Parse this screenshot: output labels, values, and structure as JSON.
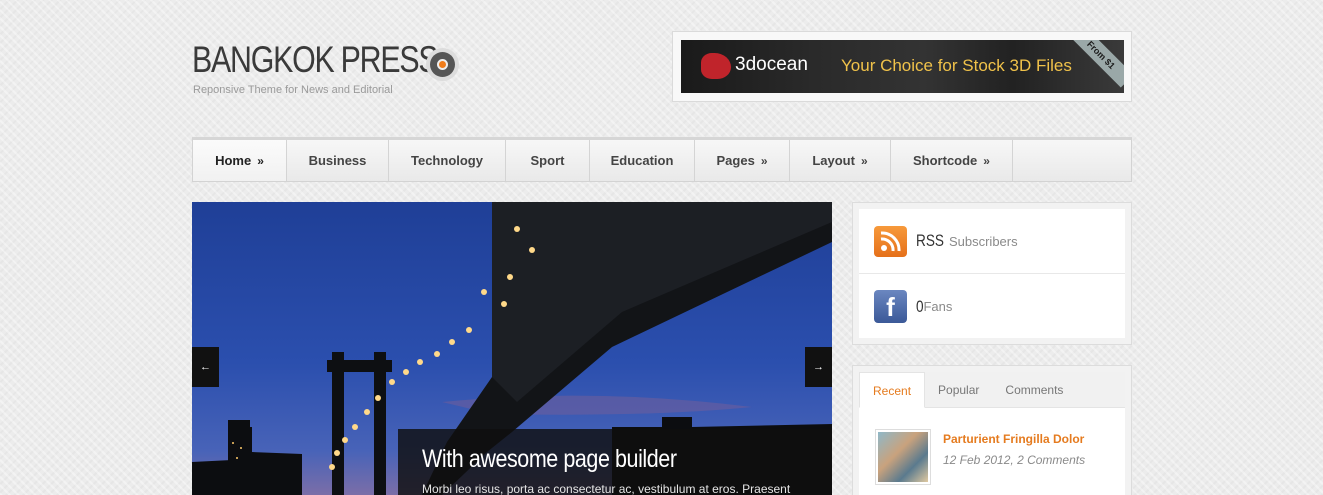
{
  "logo": {
    "title": "BANGKOK PRESS",
    "tagline": "Reponsive Theme for News and Editorial"
  },
  "ad": {
    "brand": "3docean",
    "slogan": "Your Choice for Stock 3D Files",
    "ribbon": "From $1"
  },
  "nav": {
    "items": [
      {
        "label": "Home",
        "arrow": "»"
      },
      {
        "label": "Business",
        "arrow": ""
      },
      {
        "label": "Technology",
        "arrow": ""
      },
      {
        "label": "Sport",
        "arrow": ""
      },
      {
        "label": "Education",
        "arrow": ""
      },
      {
        "label": "Pages",
        "arrow": "»"
      },
      {
        "label": "Layout",
        "arrow": "»"
      },
      {
        "label": "Shortcode",
        "arrow": "»"
      }
    ]
  },
  "slider": {
    "prev": "←",
    "next": "→",
    "caption_title": "With awesome page builder",
    "caption_text": "Morbi leo risus, porta ac consectetur ac, vestibulum at eros. Praesent"
  },
  "social": {
    "rss": {
      "count": "RSS",
      "label": "Subscribers"
    },
    "facebook": {
      "count": "0",
      "label": "Fans",
      "icon_letter": "f"
    }
  },
  "tabs": {
    "labels": [
      "Recent",
      "Popular",
      "Comments"
    ],
    "post": {
      "title": "Parturient Fringilla Dolor",
      "date": "12 Feb 2012",
      "comments": "2 Comments"
    }
  },
  "colors": {
    "accent": "#e57b1f",
    "rss": "#f07c1a",
    "facebook": "#3b5998"
  }
}
